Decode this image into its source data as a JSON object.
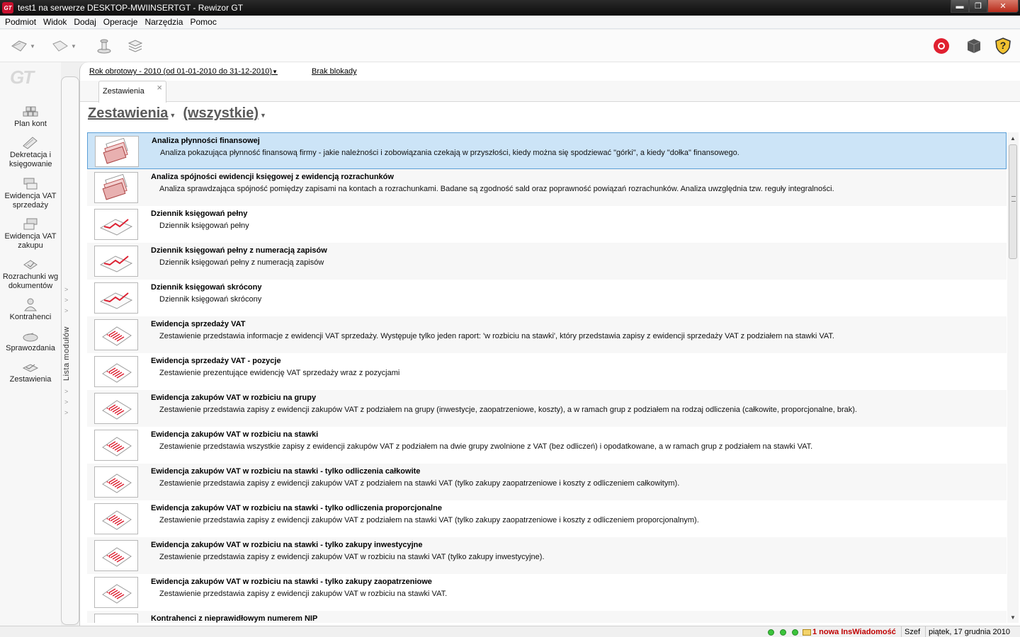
{
  "window": {
    "title": "test1 na serwerze DESKTOP-MWIINSERTGT - Rewizor GT",
    "app_icon": "GT",
    "minimize": "▬",
    "maximize": "❐",
    "close": "✕"
  },
  "menu": [
    "Podmiot",
    "Widok",
    "Dodaj",
    "Operacje",
    "Narzędzia",
    "Pomoc"
  ],
  "toolbar": {
    "left_icons": [
      "back-icon",
      "forward-icon",
      "stamp-icon",
      "layers-icon"
    ],
    "right_icons": [
      "lifebuoy-icon",
      "box-icon",
      "help-shield-icon"
    ],
    "help_label": "?"
  },
  "logo_text": "GT",
  "nav": [
    {
      "label": "Plan kont",
      "icon": "chart-of-accounts-icon"
    },
    {
      "label": "Dekretacja i księgowanie",
      "icon": "posting-icon"
    },
    {
      "label": "Ewidencja VAT sprzedaży",
      "icon": "vat-sales-icon"
    },
    {
      "label": "Ewidencja VAT zakupu",
      "icon": "vat-purchase-icon"
    },
    {
      "label": "Rozrachunki wg dokumentów",
      "icon": "settlements-icon"
    },
    {
      "label": "Kontrahenci",
      "icon": "contractors-icon"
    },
    {
      "label": "Sprawozdania",
      "icon": "reports-icon"
    },
    {
      "label": "Zestawienia",
      "icon": "statements-icon"
    }
  ],
  "module_strip_label": "Lista modułów",
  "year_selector": "Rok obrotowy - 2010  (od 01-01-2010 do 31-12-2010)",
  "lock_status": "Brak blokady",
  "tab": {
    "label": "Zestawienia",
    "close": "×"
  },
  "heading": {
    "primary": "Zestawienia",
    "filter": "(wszystkie)"
  },
  "reports": [
    {
      "title": "Analiza płynności finansowej",
      "desc": "Analiza pokazująca płynność finansową firmy - jakie należności i zobowiązania czekają w przyszłości, kiedy można się spodziewać \"górki\", a kiedy \"dołka\" finansowego.",
      "icon": "money-stack-icon"
    },
    {
      "title": "Analiza spójności ewidencji księgowej z ewidencją rozrachunków",
      "desc": "Analiza sprawdzająca spójność pomiędzy zapisami na kontach a rozrachunkami. Badane są zgodność sald oraz poprawność powiązań rozrachunków. Analiza uwzględnia tzw. reguły integralności.",
      "icon": "money-stack-icon"
    },
    {
      "title": "Dziennik księgowań pełny",
      "desc": "Dziennik księgowań pełny",
      "icon": "line-chart-icon"
    },
    {
      "title": "Dziennik księgowań pełny z numeracją zapisów",
      "desc": "Dziennik księgowań pełny z numeracją zapisów",
      "icon": "line-chart-icon"
    },
    {
      "title": "Dziennik księgowań skrócony",
      "desc": "Dziennik księgowań skrócony",
      "icon": "line-chart-icon"
    },
    {
      "title": "Ewidencja sprzedaży VAT",
      "desc": "Zestawienie przedstawia informacje z ewidencji VAT sprzedaży. Występuje tylko jeden raport: 'w rozbiciu na stawki', który przedstawia zapisy z ewidencji sprzedaży VAT z podziałem na stawki VAT.",
      "icon": "list-document-icon"
    },
    {
      "title": "Ewidencja sprzedaży VAT - pozycje",
      "desc": "Zestawienie prezentujące ewidencję VAT sprzedaży wraz z pozycjami",
      "icon": "list-document-icon"
    },
    {
      "title": "Ewidencja zakupów VAT w rozbiciu na grupy",
      "desc": "Zestawienie przedstawia zapisy z ewidencji zakupów VAT z podziałem na grupy (inwestycje, zaopatrzeniowe, koszty), a w ramach grup z podziałem na rodzaj odliczenia (całkowite, proporcjonalne, brak).",
      "icon": "list-document-icon"
    },
    {
      "title": "Ewidencja zakupów VAT w rozbiciu na stawki",
      "desc": "Zestawienie przedstawia wszystkie zapisy z ewidencji zakupów VAT z podziałem na dwie grupy zwolnione z VAT (bez odliczeń) i opodatkowane, a w ramach grup z podziałem na stawki VAT.",
      "icon": "list-document-icon"
    },
    {
      "title": "Ewidencja zakupów VAT w rozbiciu na stawki - tylko odliczenia całkowite",
      "desc": "Zestawienie przedstawia zapisy z ewidencji zakupów VAT z podziałem na stawki VAT (tylko zakupy zaopatrzeniowe i koszty z odliczeniem całkowitym).",
      "icon": "list-document-icon"
    },
    {
      "title": "Ewidencja zakupów VAT w rozbiciu na stawki - tylko odliczenia proporcjonalne",
      "desc": "Zestawienie przedstawia zapisy z ewidencji zakupów VAT z podziałem na stawki VAT (tylko zakupy zaopatrzeniowe i koszty z odliczeniem proporcjonalnym).",
      "icon": "list-document-icon"
    },
    {
      "title": "Ewidencja zakupów VAT w rozbiciu na stawki - tylko zakupy inwestycyjne",
      "desc": "Zestawienie przedstawia zapisy z ewidencji zakupów VAT w rozbiciu na stawki VAT (tylko zakupy inwestycyjne).",
      "icon": "list-document-icon"
    },
    {
      "title": "Ewidencja zakupów VAT w rozbiciu na stawki - tylko zakupy zaopatrzeniowe",
      "desc": "Zestawienie przedstawia zapisy z ewidencji zakupów VAT w rozbiciu na stawki VAT.",
      "icon": "list-document-icon"
    },
    {
      "title": "Kontrahenci z nieprawidłowym numerem NIP",
      "desc": "",
      "icon": "line-chart-icon"
    }
  ],
  "status": {
    "notification": "1 nowa InsWiadomość",
    "user": "Szef",
    "date": "piątek, 17 grudnia 2010"
  }
}
